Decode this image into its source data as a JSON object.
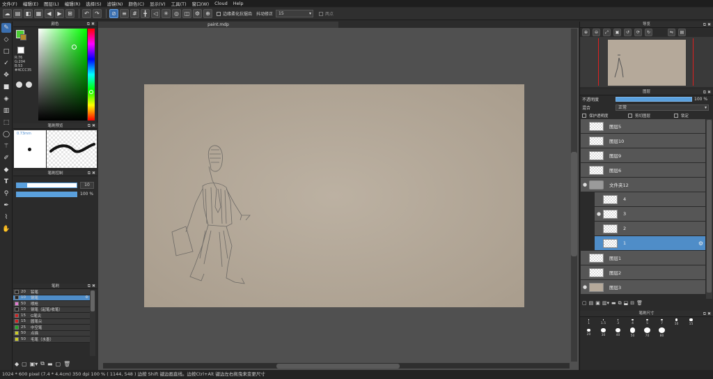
{
  "menu": [
    "文件(F)",
    "编辑(E)",
    "图层(L)",
    "编辑(R)",
    "选择(S)",
    "滤镜(N)",
    "颜色(C)",
    "显示(V)",
    "工具(T)",
    "窗口(W)",
    "Cloud",
    "Help"
  ],
  "toolbar": {
    "anti_alias_label": "边缘柔化抗锯齿",
    "stabilizer_label": "抖动修正",
    "stabilizer_value": "15",
    "snap_label": "两点"
  },
  "color_panel": {
    "title": "颜色",
    "r": "R:76",
    "g": "G:204",
    "b": "B:53",
    "hex": "#4CCC35",
    "fg_color": "#4CCC35",
    "bg_color": "#ffffff"
  },
  "brush_preview": {
    "title": "笔刷预览",
    "size": "0.73mm"
  },
  "brush_control": {
    "title": "笔刷控制",
    "size_value": "10",
    "opacity_value": "100 %"
  },
  "brush_list": {
    "title": "笔刷",
    "items": [
      {
        "num": "20",
        "name": "铅笔",
        "color": "#222222",
        "selected": false
      },
      {
        "num": "10",
        "name": "钢笔",
        "color": "#222222",
        "selected": true
      },
      {
        "num": "50",
        "name": "喷枪",
        "color": "#e07ad0",
        "selected": false
      },
      {
        "num": "10",
        "name": "钢笔（起笔/收笔）",
        "color": "#222222",
        "selected": false
      },
      {
        "num": "15",
        "name": "G笔尖",
        "color": "#cc2222",
        "selected": false
      },
      {
        "num": "15",
        "name": "圆笔尖",
        "color": "#cc2222",
        "selected": false
      },
      {
        "num": "25",
        "name": "中空笔",
        "color": "#22aa22",
        "selected": false
      },
      {
        "num": "50",
        "name": "点描",
        "color": "#cccc22",
        "selected": false
      },
      {
        "num": "50",
        "name": "毛笔（水墨）",
        "color": "#cccc22",
        "selected": false
      }
    ]
  },
  "document": {
    "tab": "paint.mdp"
  },
  "navigator": {
    "title": "导览"
  },
  "layers": {
    "title": "图层",
    "opacity_label": "不透明度",
    "opacity_value": "100 %",
    "opacity_fraction": 1.0,
    "blend_label": "混合",
    "blend_value": "正常",
    "protect_alpha": "保护透明度",
    "clipping": "剪切图层",
    "lock": "锁定",
    "items": [
      {
        "name": "图层5",
        "indent": 0,
        "selected": false,
        "eye": false,
        "folder": false
      },
      {
        "name": "图层10",
        "indent": 0,
        "selected": false,
        "eye": false,
        "folder": false
      },
      {
        "name": "图层9",
        "indent": 0,
        "selected": false,
        "eye": false,
        "folder": false
      },
      {
        "name": "图层6",
        "indent": 0,
        "selected": false,
        "eye": false,
        "folder": false
      },
      {
        "name": "文件夹12",
        "indent": 0,
        "selected": false,
        "eye": true,
        "folder": true
      },
      {
        "name": "4",
        "indent": 1,
        "selected": false,
        "eye": false,
        "folder": false
      },
      {
        "name": "3",
        "indent": 1,
        "selected": false,
        "eye": true,
        "folder": false
      },
      {
        "name": "2",
        "indent": 1,
        "selected": false,
        "eye": false,
        "folder": false
      },
      {
        "name": "1",
        "indent": 1,
        "selected": true,
        "eye": false,
        "folder": false
      },
      {
        "name": "图层1",
        "indent": 0,
        "selected": false,
        "eye": false,
        "folder": false
      },
      {
        "name": "图层2",
        "indent": 0,
        "selected": false,
        "eye": false,
        "folder": false
      },
      {
        "name": "图层3",
        "indent": 0,
        "selected": false,
        "eye": true,
        "folder": false
      }
    ]
  },
  "brush_size": {
    "title": "笔刷尺寸",
    "sizes": [
      "1",
      "1.5",
      "3",
      "4",
      "5",
      "7",
      "10",
      "15",
      "20",
      "30",
      "40",
      "50",
      "70",
      "80"
    ]
  },
  "status": {
    "text": "1024 * 600 pixel   (7.4 * 4.4cm)   350 dpi   100 %   ( 1144, 548 )   边按 Shift 键边画直线。边按Ctrl+Alt 键边左右拖曳来变更尺寸"
  }
}
